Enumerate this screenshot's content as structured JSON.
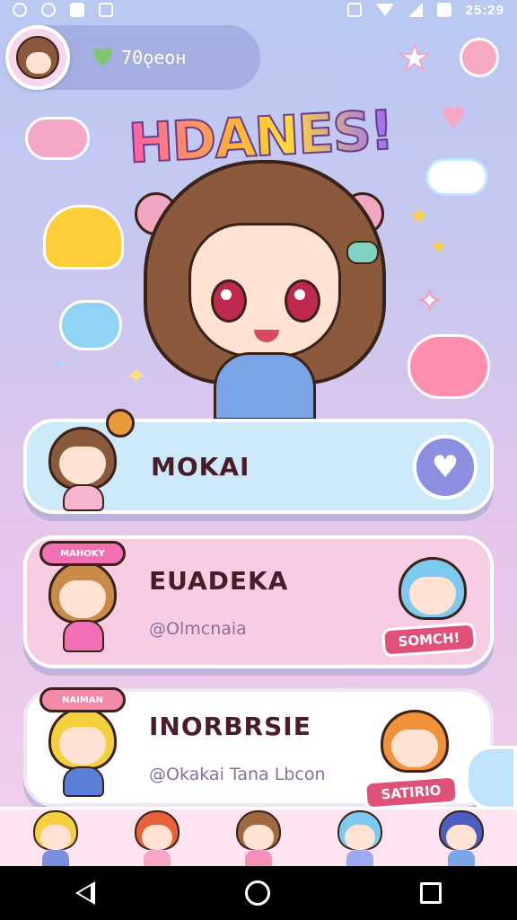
{
  "status_bar": {
    "time": "25:29"
  },
  "profile": {
    "status_text": "70ǫeoн"
  },
  "title": "HDANES!",
  "cards": [
    {
      "name": "MOKAI",
      "handle": ""
    },
    {
      "name": "EUADEKA",
      "handle": "@Olmcnaia",
      "hat_text": "MAHOKY",
      "sticker_tag": "SOMCH!"
    },
    {
      "name": "INORBRSIE",
      "handle": "@Okakai Tana Lbcon",
      "hat_text": "NAIMAN",
      "sticker_tag": "SATIRIO"
    }
  ],
  "colors": {
    "accent": "#8d90e0",
    "pink": "#f8cde3",
    "blue": "#cdeafb",
    "text_dark": "#4a1c28"
  },
  "icons": {
    "like": "heart-icon",
    "back": "back-icon",
    "home": "home-icon",
    "recents": "recents-icon"
  },
  "bottom_strip": [
    "avatar-blonde",
    "avatar-redhead",
    "avatar-brunette",
    "avatar-blue",
    "avatar-navy"
  ]
}
